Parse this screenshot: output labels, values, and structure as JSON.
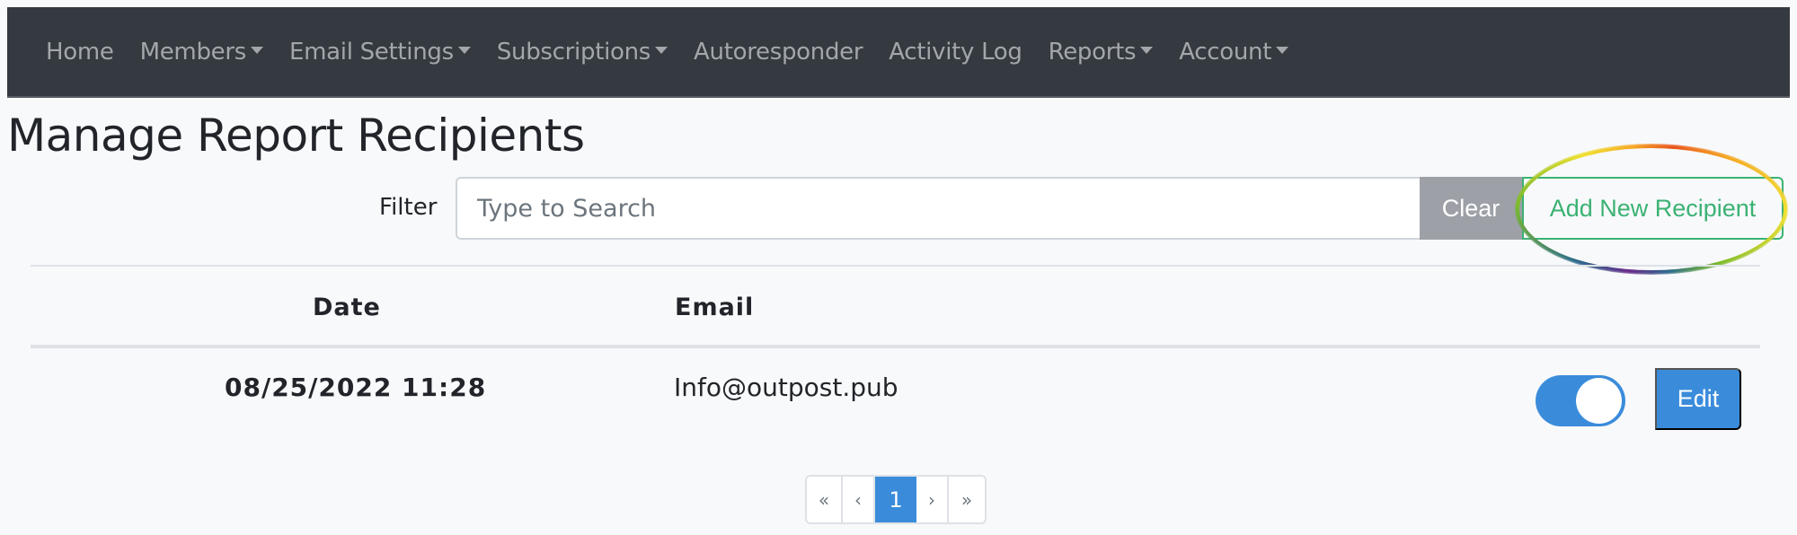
{
  "navbar": {
    "items": [
      {
        "label": "Home",
        "dropdown": false
      },
      {
        "label": "Members",
        "dropdown": true
      },
      {
        "label": "Email Settings",
        "dropdown": true
      },
      {
        "label": "Subscriptions",
        "dropdown": true
      },
      {
        "label": "Autoresponder",
        "dropdown": false
      },
      {
        "label": "Activity Log",
        "dropdown": false
      },
      {
        "label": "Reports",
        "dropdown": true
      },
      {
        "label": "Account",
        "dropdown": true
      }
    ]
  },
  "page": {
    "title": "Manage Report Recipients"
  },
  "filter": {
    "label": "Filter",
    "placeholder": "Type to Search",
    "value": "",
    "clear_label": "Clear",
    "add_label": "Add New Recipient"
  },
  "table": {
    "headers": [
      "Date",
      "Email",
      ""
    ],
    "rows": [
      {
        "date": "08/25/2022 11:28",
        "email": "Info@outpost.pub",
        "enabled": true,
        "edit_label": "Edit"
      }
    ]
  },
  "pagination": {
    "first": "«",
    "prev": "‹",
    "current": "1",
    "next": "›",
    "last": "»"
  },
  "colors": {
    "navbar_bg": "#343a40",
    "primary": "#3a8cdb",
    "success": "#3bb273",
    "secondary": "#9da1a7"
  }
}
